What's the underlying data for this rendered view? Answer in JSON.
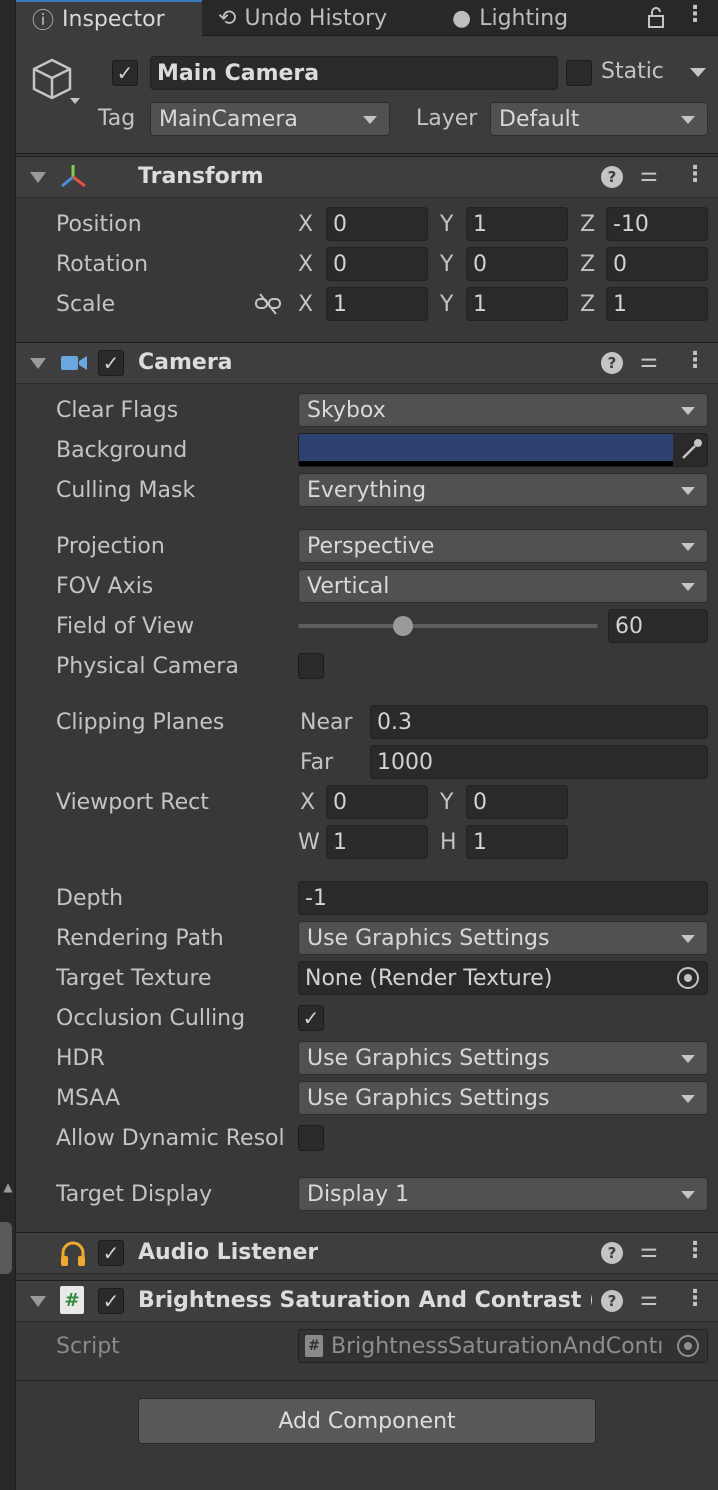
{
  "tabs": [
    {
      "label": "Inspector",
      "icon": "info-icon"
    },
    {
      "label": "Undo History",
      "icon": "history-icon"
    },
    {
      "label": "Lighting",
      "icon": "lightbulb-icon"
    }
  ],
  "object": {
    "name": "Main Camera",
    "static_label": "Static",
    "tag_label": "Tag",
    "tag_value": "MainCamera",
    "layer_label": "Layer",
    "layer_value": "Default"
  },
  "transform": {
    "title": "Transform",
    "position": {
      "label": "Position",
      "x": "0",
      "y": "1",
      "z": "-10"
    },
    "rotation": {
      "label": "Rotation",
      "x": "0",
      "y": "0",
      "z": "0"
    },
    "scale": {
      "label": "Scale",
      "x": "1",
      "y": "1",
      "z": "1"
    },
    "axis_x": "X",
    "axis_y": "Y",
    "axis_z": "Z"
  },
  "camera": {
    "title": "Camera",
    "clear_flags": {
      "label": "Clear Flags",
      "value": "Skybox"
    },
    "background": {
      "label": "Background",
      "color": "#2e4270"
    },
    "culling_mask": {
      "label": "Culling Mask",
      "value": "Everything"
    },
    "projection": {
      "label": "Projection",
      "value": "Perspective"
    },
    "fov_axis": {
      "label": "FOV Axis",
      "value": "Vertical"
    },
    "field_of_view": {
      "label": "Field of View",
      "value": "60",
      "slider_fraction": 0.35
    },
    "physical_camera": {
      "label": "Physical Camera"
    },
    "clipping": {
      "label": "Clipping Planes",
      "near_label": "Near",
      "near": "0.3",
      "far_label": "Far",
      "far": "1000"
    },
    "viewport": {
      "label": "Viewport Rect",
      "x_label": "X",
      "x": "0",
      "y_label": "Y",
      "y": "0",
      "w_label": "W",
      "w": "1",
      "h_label": "H",
      "h": "1"
    },
    "depth": {
      "label": "Depth",
      "value": "-1"
    },
    "rendering_path": {
      "label": "Rendering Path",
      "value": "Use Graphics Settings"
    },
    "target_texture": {
      "label": "Target Texture",
      "value": "None (Render Texture)"
    },
    "occlusion_culling": {
      "label": "Occlusion Culling"
    },
    "hdr": {
      "label": "HDR",
      "value": "Use Graphics Settings"
    },
    "msaa": {
      "label": "MSAA",
      "value": "Use Graphics Settings"
    },
    "dynamic_res": {
      "label": "Allow Dynamic Resol"
    },
    "target_display": {
      "label": "Target Display",
      "value": "Display 1"
    }
  },
  "audio_listener": {
    "title": "Audio Listener"
  },
  "bsc": {
    "title": "Brightness Saturation And Contrast (S",
    "script_label": "Script",
    "script_value": "BrightnessSaturationAndContı"
  },
  "add_component": "Add Component",
  "colors": {
    "accent": "#3a79bb",
    "panel": "#383838",
    "field": "#2a2a2a"
  }
}
